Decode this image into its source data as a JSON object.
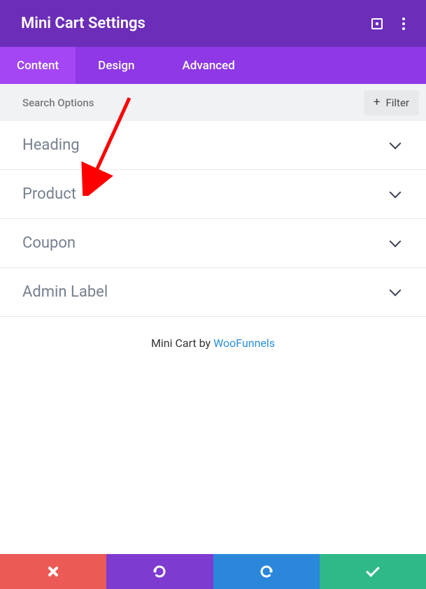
{
  "header": {
    "title": "Mini Cart Settings"
  },
  "tabs": {
    "content": "Content",
    "design": "Design",
    "advanced": "Advanced"
  },
  "search": {
    "placeholder": "Search Options",
    "filter_label": "Filter"
  },
  "sections": {
    "heading": "Heading",
    "product": "Product",
    "coupon": "Coupon",
    "admin_label": "Admin Label"
  },
  "footer": {
    "prefix": "Mini Cart by ",
    "link_text": "WooFunnels"
  }
}
